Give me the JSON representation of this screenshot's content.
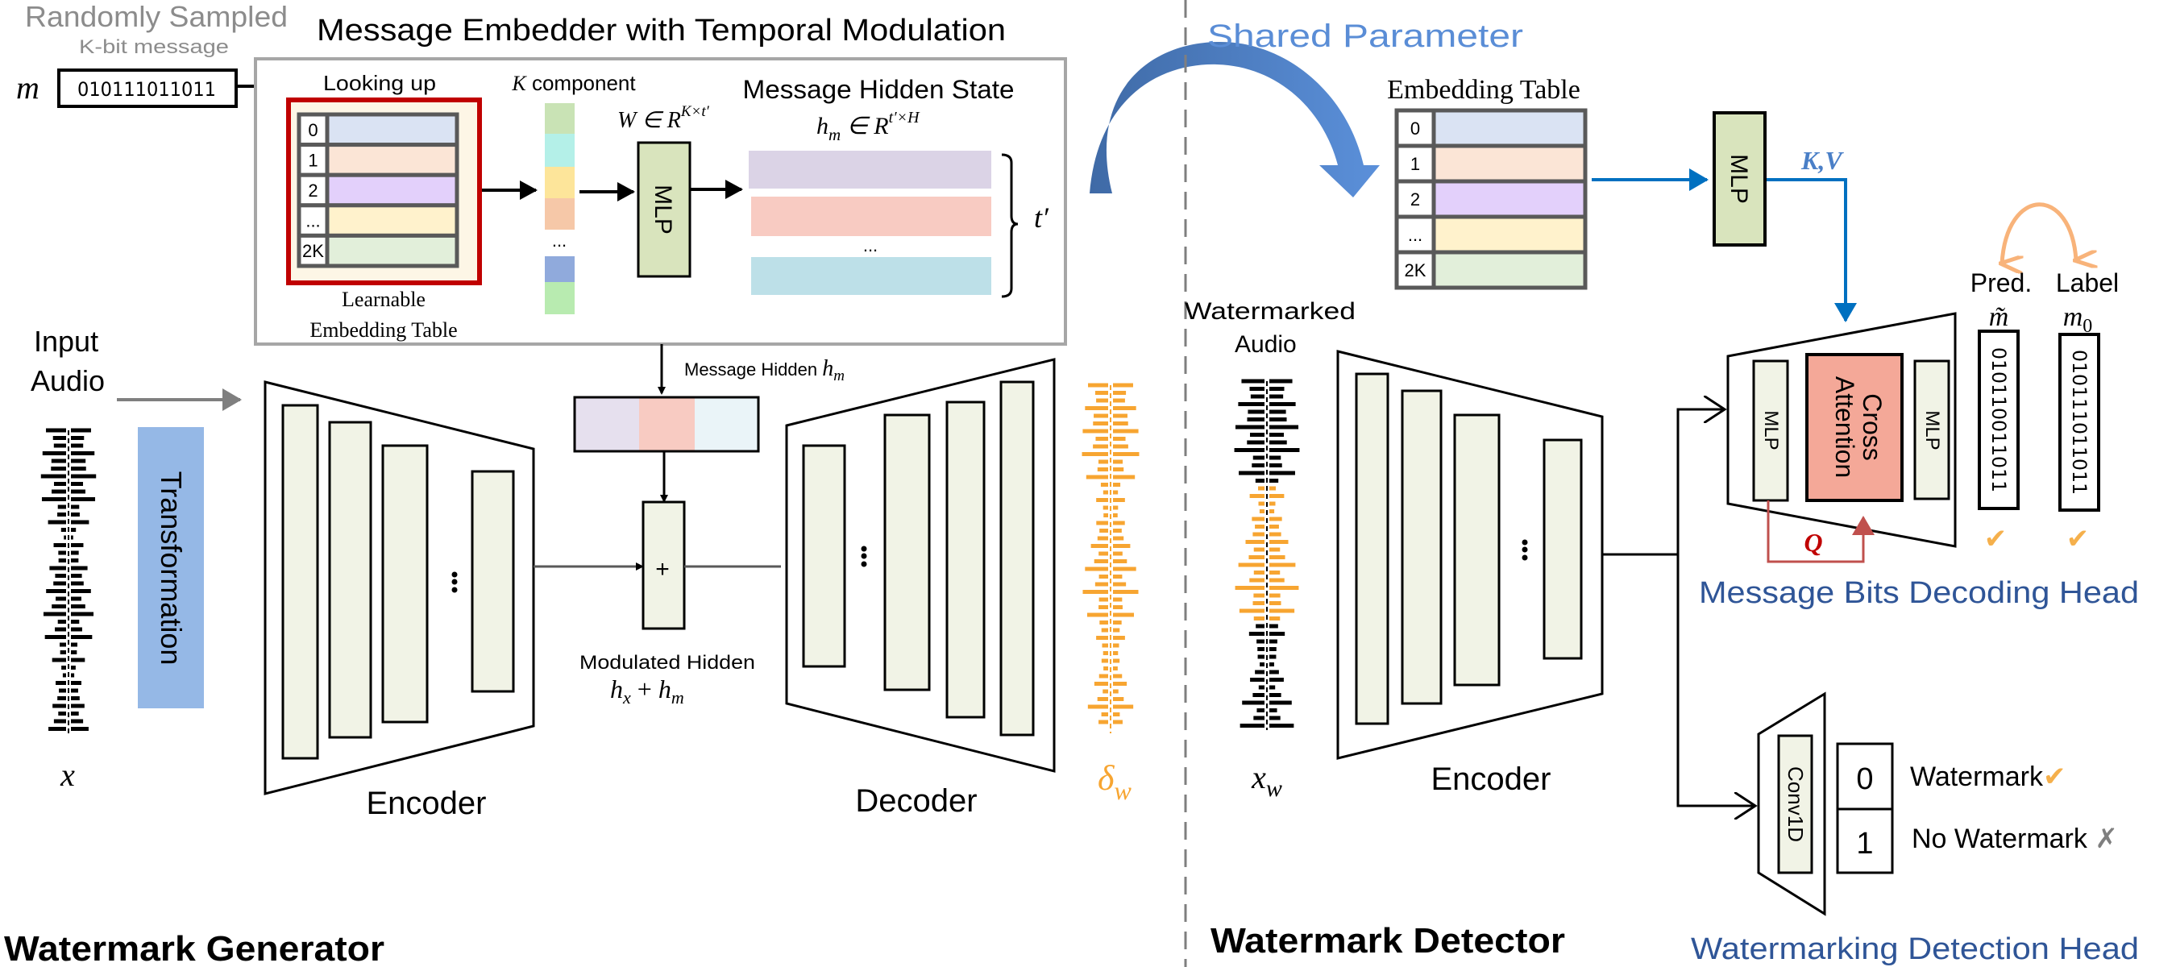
{
  "generator": {
    "random_title": "Randomly Sampled",
    "random_subtitle": "K-bit message",
    "message_symbol": "m",
    "message_bits": "010111011011",
    "embedder_title": "Message Embedder with Temporal Modulation",
    "looking_up": "Looking up",
    "table_indices": [
      "0",
      "1",
      "2",
      "...",
      "2K"
    ],
    "table_caption_1": "Learnable",
    "table_caption_2": "Embedding Table",
    "k_component": {
      "symbol": "K",
      "text": " component"
    },
    "weight": {
      "base": "W ∈ R",
      "sup": "K×t′"
    },
    "mlp_label": "MLP",
    "hidden_state_title": "Message Hidden State",
    "hidden_state_math": {
      "base": "h",
      "sub": "m",
      "mid": " ∈ R",
      "sup": "t′×H"
    },
    "dots": "...",
    "t_prime": "t′",
    "input_audio_1": "Input",
    "input_audio_2": "Audio",
    "transformation": "Transformation",
    "x_symbol": "x",
    "encoder_label": "Encoder",
    "decoder_label": "Decoder",
    "message_hidden": {
      "text": "Message Hidden ",
      "base": "h",
      "sub": "m"
    },
    "plus": "+",
    "modulated_hidden": "Modulated Hidden",
    "modulated_math": {
      "a": "h",
      "asub": "x",
      "op": " + ",
      "b": "h",
      "bsub": "m"
    },
    "delta": {
      "base": "δ",
      "sub": "w"
    },
    "section_title": "Watermark  Generator"
  },
  "shared_parameter": "Shared Parameter",
  "detector": {
    "embedding_table_title": "Embedding Table",
    "table_indices": [
      "0",
      "1",
      "2",
      "...",
      "2K"
    ],
    "mlp_label": "MLP",
    "kv_label": "K,V",
    "watermarked_audio_1": "Watermarked",
    "watermarked_audio_2": "Audio",
    "xw": {
      "base": "x",
      "sub": "w"
    },
    "encoder_label": "Encoder",
    "decoding_head": {
      "mlp_left": "MLP",
      "cross_attention_1": "Cross",
      "cross_attention_2": "Attention",
      "mlp_right": "MLP",
      "q_label": "Q",
      "pred_label": "Pred.",
      "label_label": "Label",
      "pred_symbol": "m̃",
      "label_symbol": {
        "base": "m",
        "sub": "0"
      },
      "pred_bits": "010110011011",
      "label_bits": "010111011011",
      "check": "✔",
      "title": "Message Bits Decoding Head"
    },
    "detection_head": {
      "conv_label": "Conv1D",
      "class_0": "0",
      "class_1": "1",
      "watermark": "Watermark",
      "watermark_mark": "✔",
      "no_watermark": "No Watermark ",
      "no_watermark_mark": "✗",
      "title": "Watermarking Detection Head"
    },
    "section_title": "Watermark  Detector"
  },
  "colors": {
    "shared_blue": "#5a8dd6",
    "head_title_blue": "#2f5597",
    "kv_blue": "#0070c0",
    "query_red": "#c0504d",
    "watermark_orange": "#f7a531",
    "embedding_rows": [
      "#dae3f3",
      "#fbe5d6",
      "#e3d0fb",
      "#fff2cc",
      "#e2efda"
    ],
    "components": [
      "#c9e3b5",
      "#b4f0e8",
      "#fde59a",
      "#f6c8a8",
      "#90aadc",
      "#b8ebb0"
    ],
    "hidden_bars": [
      "#dbd3e6",
      "#f8cbc2",
      "#bde0e8"
    ],
    "mlp_fill": "#d9e4bd",
    "block_fill": "#f1f3e6",
    "cross_attention_fill": "#f4a898",
    "transformation_fill": "#95b8e6",
    "lookup_box_red": "#c00000"
  }
}
